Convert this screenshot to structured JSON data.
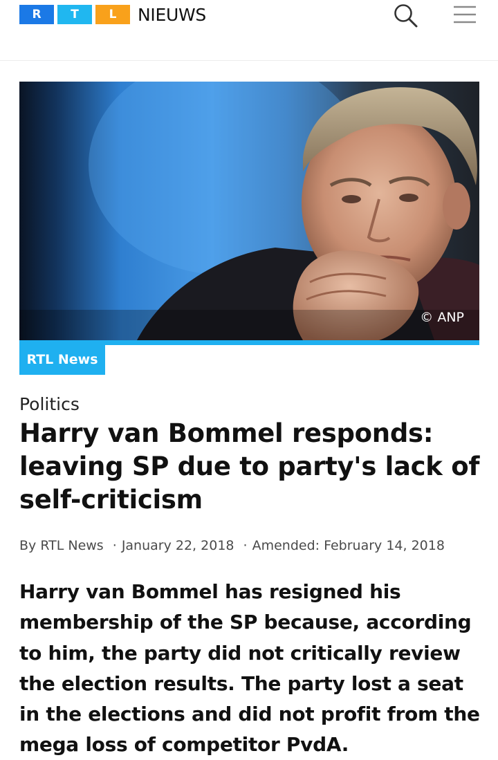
{
  "header": {
    "logo": {
      "letters": [
        "R",
        "T",
        "L"
      ],
      "word": "NIEUWS",
      "colors": [
        "#1b79e6",
        "#20b7f0",
        "#f9a11b"
      ]
    },
    "search_icon": "search-icon",
    "menu_icon": "hamburger-menu-icon"
  },
  "hero": {
    "image": "portrait-photo",
    "credit": "© ANP",
    "accent_color": "#1fb0f0"
  },
  "article": {
    "source_label": "RTL News",
    "category": "Politics",
    "headline": "Harry van Bommel responds: leaving SP due to party's lack of self-criticism",
    "byline": "By RTL News",
    "date": "January 22, 2018",
    "amended": "Amended: February 14, 2018",
    "lead": "Harry van Bommel has resigned his membership of the SP because, according to him, the party did not critically review the election results. The party lost a seat in the elections and did not profit from the mega loss of competitor PvdA."
  }
}
